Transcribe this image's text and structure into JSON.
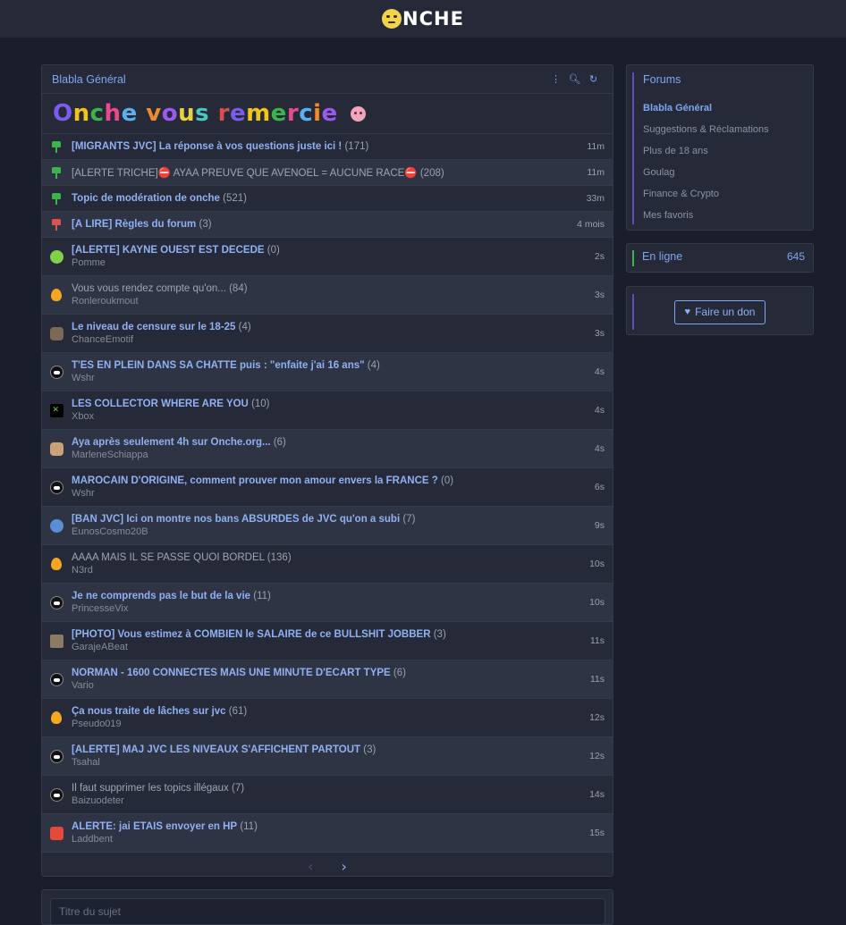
{
  "brand": {
    "name": "NCHE"
  },
  "forum": {
    "title": "Blabla Général",
    "banner": "Onche vous remercie",
    "banner_colors": [
      "#7c5cf0",
      "#f0c419",
      "#3bb54a",
      "#e84b8a",
      "#5ab0f0",
      "#f08a2b",
      "#9b59f0",
      "#e8d23b",
      "#4ac7c0",
      "#d94f4f",
      "#7c5cf0",
      "#f0c419",
      "#3bb54a",
      "#e84b8a",
      "#5ab0f0",
      "#f08a2b",
      "#9b59f0",
      "#e8d23b",
      "#4ac7c0"
    ]
  },
  "topics": [
    {
      "pinned": true,
      "pin_color": "green",
      "title": "[MIGRANTS JVC] La réponse à vos questions juste ici !",
      "count": "(171)",
      "time": "11m",
      "bold": true,
      "grey": false,
      "alt": false
    },
    {
      "pinned": true,
      "pin_color": "green",
      "title": "[ALERTE TRICHE]⛔ AYAA PREUVE QUE AVENOEL = AUCUNE RACE⛔",
      "count": "(208)",
      "time": "11m",
      "bold": false,
      "grey": true,
      "alt": true
    },
    {
      "pinned": true,
      "pin_color": "green",
      "title": "Topic de modération de onche",
      "count": "(521)",
      "time": "33m",
      "bold": true,
      "grey": false,
      "alt": false
    },
    {
      "pinned": true,
      "pin_color": "red",
      "title": "[À LIRE] Règles du forum",
      "count": "(3)",
      "time": "4 mois",
      "bold": true,
      "grey": false,
      "alt": true
    },
    {
      "pinned": false,
      "avatar": "green",
      "title": "[ALERTE] KAYNE OUEST EST DECEDÉ",
      "count": "(0)",
      "author": "Pomme",
      "time": "2s",
      "bold": true,
      "grey": false,
      "alt": false
    },
    {
      "pinned": false,
      "avatar": "fire",
      "title": "Vous vous rendez compte qu'on...",
      "count": "(84)",
      "author": "Ronleroukmout",
      "time": "3s",
      "bold": false,
      "grey": true,
      "alt": true
    },
    {
      "pinned": false,
      "avatar": "person",
      "title": "Le niveau de censure sur le 18-25",
      "count": "(4)",
      "author": "ChanceEmotif",
      "time": "3s",
      "bold": true,
      "grey": false,
      "alt": false
    },
    {
      "pinned": false,
      "avatar": "bw",
      "title": "T'ES EN PLEIN DANS SA CHATTE puis : \"enfaite j'ai 16 ans\"",
      "count": "(4)",
      "author": "Wshr",
      "time": "4s",
      "bold": true,
      "grey": false,
      "alt": true
    },
    {
      "pinned": false,
      "avatar": "xbox",
      "title": "LES COLLECTOR WHERE ARE YOU",
      "count": "(10)",
      "author": "Xbox",
      "time": "4s",
      "bold": true,
      "grey": false,
      "alt": false
    },
    {
      "pinned": false,
      "avatar": "face",
      "title": "Aya après seulement 4h sur Onche.org...",
      "count": "(6)",
      "author": "MarleneSchiappa",
      "time": "4s",
      "bold": true,
      "grey": false,
      "alt": true
    },
    {
      "pinned": false,
      "avatar": "bw",
      "title": "MAROCAIN D'ORIGINE, comment prouver mon amour envers la FRANCE ?",
      "count": "(0)",
      "author": "Wshr",
      "time": "6s",
      "bold": true,
      "grey": false,
      "alt": false
    },
    {
      "pinned": false,
      "avatar": "blue",
      "title": "[BAN JVC] Ici on montre nos bans ABSURDES de JVC qu'on a subi",
      "count": "(7)",
      "author": "EunosCosmo20B",
      "time": "9s",
      "bold": true,
      "grey": false,
      "alt": true
    },
    {
      "pinned": false,
      "avatar": "fire",
      "title": "AAAA MAIS IL SE PASSE QUOI BORDEL",
      "count": "(136)",
      "author": "N3rd",
      "time": "10s",
      "bold": false,
      "grey": true,
      "alt": false
    },
    {
      "pinned": false,
      "avatar": "bw",
      "title": "Je ne comprends pas le but de la vie",
      "count": "(11)",
      "author": "PrincesseVix",
      "time": "10s",
      "bold": true,
      "grey": false,
      "alt": true
    },
    {
      "pinned": false,
      "avatar": "photo",
      "title": "[PHOTO] Vous estimez à COMBIEN le SALAIRE de ce BULLSHIT JOBBER",
      "count": "(3)",
      "author": "GarajeABeat",
      "time": "11s",
      "bold": true,
      "grey": false,
      "alt": false
    },
    {
      "pinned": false,
      "avatar": "bw",
      "title": "NORMAN - 1600 CONNECTES MAIS UNE MINUTE D'ECART TYPE",
      "count": "(6)",
      "author": "Vario",
      "time": "11s",
      "bold": true,
      "grey": false,
      "alt": true
    },
    {
      "pinned": false,
      "avatar": "fire",
      "title": "Ça nous traite de lâches sur jvc",
      "count": "(61)",
      "author": "Pseudo019",
      "time": "12s",
      "bold": true,
      "grey": false,
      "alt": false
    },
    {
      "pinned": false,
      "avatar": "bw",
      "title": "[ALERTE] MAJ JVC LES NIVEAUX S'AFFICHENT PARTOUT",
      "count": "(3)",
      "author": "Tsahal",
      "time": "12s",
      "bold": true,
      "grey": false,
      "alt": true
    },
    {
      "pinned": false,
      "avatar": "bw",
      "title": "Il faut supprimer les topics illégaux",
      "count": "(7)",
      "author": "Baizuodeter",
      "time": "14s",
      "bold": false,
      "grey": true,
      "alt": false
    },
    {
      "pinned": false,
      "avatar": "mario",
      "title": "ALERTE: jai ETAIS envoyer en HP",
      "count": "(11)",
      "author": "Laddbent",
      "time": "15s",
      "bold": true,
      "grey": false,
      "alt": true
    }
  ],
  "pager": {
    "prev": "‹",
    "next": "›"
  },
  "editor": {
    "placeholder": "Titre du sujet"
  },
  "sidebar": {
    "forums_title": "Forums",
    "forums": [
      {
        "label": "Blabla Général",
        "active": true
      },
      {
        "label": "Suggestions & Réclamations",
        "active": false
      },
      {
        "label": "Plus de 18 ans",
        "active": false
      },
      {
        "label": "Goulag",
        "active": false
      },
      {
        "label": "Finance & Crypto",
        "active": false
      },
      {
        "label": "Mes favoris",
        "active": false
      }
    ],
    "online_label": "En ligne",
    "online_count": "645",
    "donate_label": "Faire un don"
  },
  "colors": {
    "accent": "#7ea6f0",
    "background": "#1a1e2a",
    "panel": "#262a38",
    "pin_green": "#3bb54a",
    "pin_red": "#d94f4f"
  }
}
